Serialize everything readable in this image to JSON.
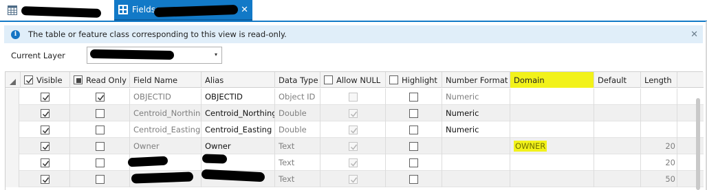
{
  "tabs": [
    {
      "label": "",
      "icon": "table-icon",
      "active": false
    },
    {
      "label": "Fields:",
      "icon": "fields-view-icon",
      "active": true,
      "close": "✕"
    }
  ],
  "info_bar": {
    "icon": "info-icon",
    "message": "The table or feature class corresponding to this view is read-only.",
    "close": "✕"
  },
  "current_layer": {
    "label": "Current Layer",
    "value": "",
    "caret": "▾"
  },
  "grid": {
    "columns": [
      "Visible",
      "Read Only",
      "Field Name",
      "Alias",
      "Data Type",
      "Allow NULL",
      "Highlight",
      "Number Format",
      "Domain",
      "Default",
      "Length"
    ],
    "header_checkbox_state": {
      "Visible": "checked",
      "Read Only": "indeterminate",
      "Allow NULL": "unchecked",
      "Highlight": "unchecked"
    },
    "highlighted_column": "Domain",
    "highlight_color": "#f2f21a",
    "rows": [
      {
        "visible": true,
        "read_only": true,
        "field_name": "OBJECTID",
        "alias": "OBJECTID",
        "data_type": "Object ID",
        "allow_null": false,
        "allow_null_disabled": true,
        "highlight": false,
        "number_format": "Numeric",
        "number_format_grey": true,
        "domain": "",
        "default": "",
        "length": ""
      },
      {
        "visible": true,
        "read_only": false,
        "field_name": "Centroid_Northing",
        "alias": "Centroid_Northing",
        "data_type": "Double",
        "allow_null": true,
        "allow_null_disabled": true,
        "highlight": false,
        "number_format": "Numeric",
        "number_format_grey": false,
        "domain": "",
        "default": "",
        "length": ""
      },
      {
        "visible": true,
        "read_only": false,
        "field_name": "Centroid_Easting",
        "alias": "Centroid_Easting",
        "data_type": "Double",
        "allow_null": true,
        "allow_null_disabled": true,
        "highlight": false,
        "number_format": "Numeric",
        "number_format_grey": false,
        "domain": "",
        "default": "",
        "length": ""
      },
      {
        "visible": true,
        "read_only": false,
        "field_name": "Owner",
        "alias": "Owner",
        "data_type": "Text",
        "allow_null": true,
        "allow_null_disabled": true,
        "highlight": false,
        "number_format": "",
        "number_format_grey": false,
        "domain": "OWNER",
        "default": "",
        "length": "20"
      },
      {
        "visible": true,
        "read_only": false,
        "field_name": "",
        "alias": "",
        "data_type": "Text",
        "allow_null": true,
        "allow_null_disabled": true,
        "highlight": false,
        "number_format": "",
        "number_format_grey": false,
        "domain": "",
        "default": "",
        "length": "20"
      },
      {
        "visible": true,
        "read_only": false,
        "field_name": "",
        "alias": "",
        "data_type": "Text",
        "allow_null": true,
        "allow_null_disabled": true,
        "highlight": false,
        "number_format": "",
        "number_format_grey": false,
        "domain": "",
        "default": "",
        "length": "50"
      }
    ]
  }
}
